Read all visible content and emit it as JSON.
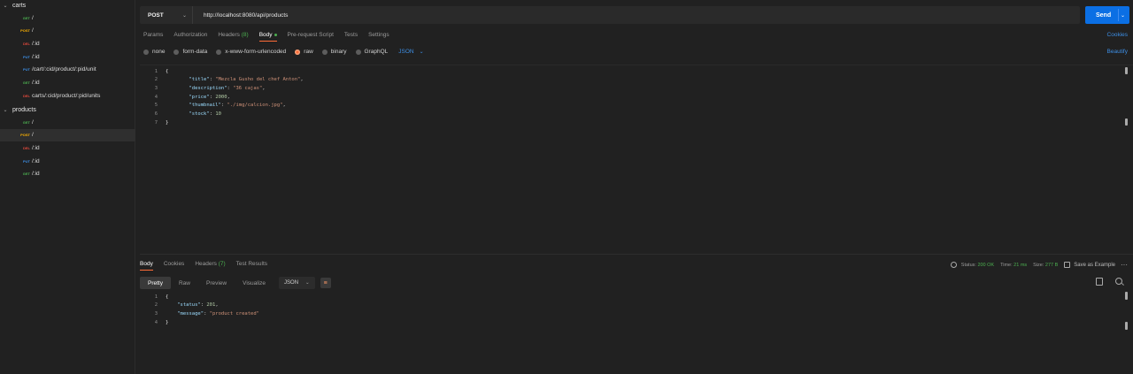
{
  "colors": {
    "get": "#4caf50",
    "post": "#ffb300",
    "put": "#3d8fe6",
    "delete": "#e0493c",
    "accent": "#ff6c37",
    "send": "#0b6fe4"
  },
  "sidebar": {
    "folders": [
      {
        "name": "carts",
        "icon": "chevron-down-icon"
      },
      {
        "name": "products",
        "icon": "chevron-down-icon"
      }
    ],
    "carts_requests": [
      {
        "method": "GET",
        "path": "/"
      },
      {
        "method": "POST",
        "path": "/"
      },
      {
        "method": "DEL",
        "path": "/:id"
      },
      {
        "method": "PUT",
        "path": "/:id"
      },
      {
        "method": "PUT",
        "path": "/cart/:cid/product/:pid/unit"
      },
      {
        "method": "GET",
        "path": "/:id"
      },
      {
        "method": "DEL",
        "path": "carts/:cid/product/:pid/units"
      }
    ],
    "products_requests": [
      {
        "method": "GET",
        "path": "/"
      },
      {
        "method": "POST",
        "path": "/"
      },
      {
        "method": "DEL",
        "path": "/:id"
      },
      {
        "method": "PUT",
        "path": "/:id"
      },
      {
        "method": "GET",
        "path": "/:id"
      }
    ]
  },
  "request": {
    "method": "POST",
    "url": "http://localhost:8080/api/products",
    "send_label": "Send",
    "tabs": [
      {
        "label": "Params"
      },
      {
        "label": "Authorization"
      },
      {
        "label": "Headers",
        "count": "(8)"
      },
      {
        "label": "Body",
        "active": true
      },
      {
        "label": "Pre-request Script"
      },
      {
        "label": "Tests"
      },
      {
        "label": "Settings"
      }
    ],
    "cookies_label": "Cookies",
    "body_types": [
      "none",
      "form-data",
      "x-www-form-urlencoded",
      "raw",
      "binary",
      "GraphQL"
    ],
    "selected_body_type": "raw",
    "format": "JSON",
    "beautify_label": "Beautify",
    "body_lines": [
      {
        "n": "1",
        "text": "{"
      },
      {
        "n": "2",
        "key": "\"title\"",
        "value": "\"Mezcla Gusho del chef Anton\"",
        "type": "str",
        "comma": true
      },
      {
        "n": "3",
        "key": "\"description\"",
        "value": "\"36 cajas\"",
        "type": "str",
        "comma": true
      },
      {
        "n": "4",
        "key": "\"price\"",
        "value": "2000",
        "type": "num",
        "comma": true
      },
      {
        "n": "5",
        "key": "\"thumbnail\"",
        "value": "\"./img/calcion.jpg\"",
        "type": "str",
        "comma": true
      },
      {
        "n": "6",
        "key": "\"stock\"",
        "value": "10",
        "type": "num",
        "comma": false
      },
      {
        "n": "7",
        "text": "}"
      }
    ]
  },
  "response": {
    "tabs": [
      {
        "label": "Body",
        "active": true
      },
      {
        "label": "Cookies"
      },
      {
        "label": "Headers",
        "count": "(7)"
      },
      {
        "label": "Test Results"
      }
    ],
    "status_label": "Status:",
    "status_value": "200 OK",
    "time_label": "Time:",
    "time_value": "21 ms",
    "size_label": "Size:",
    "size_value": "277 B",
    "save_label": "Save as Example",
    "view_tabs": [
      "Pretty",
      "Raw",
      "Preview",
      "Visualize"
    ],
    "active_view": "Pretty",
    "format": "JSON",
    "body_lines": [
      {
        "n": "1",
        "text": "{"
      },
      {
        "n": "2",
        "key": "\"status\"",
        "value": "201",
        "type": "num",
        "comma": true
      },
      {
        "n": "3",
        "key": "\"message\"",
        "value": "\"product created\"",
        "type": "str",
        "comma": false
      },
      {
        "n": "4",
        "text": "}"
      }
    ]
  }
}
